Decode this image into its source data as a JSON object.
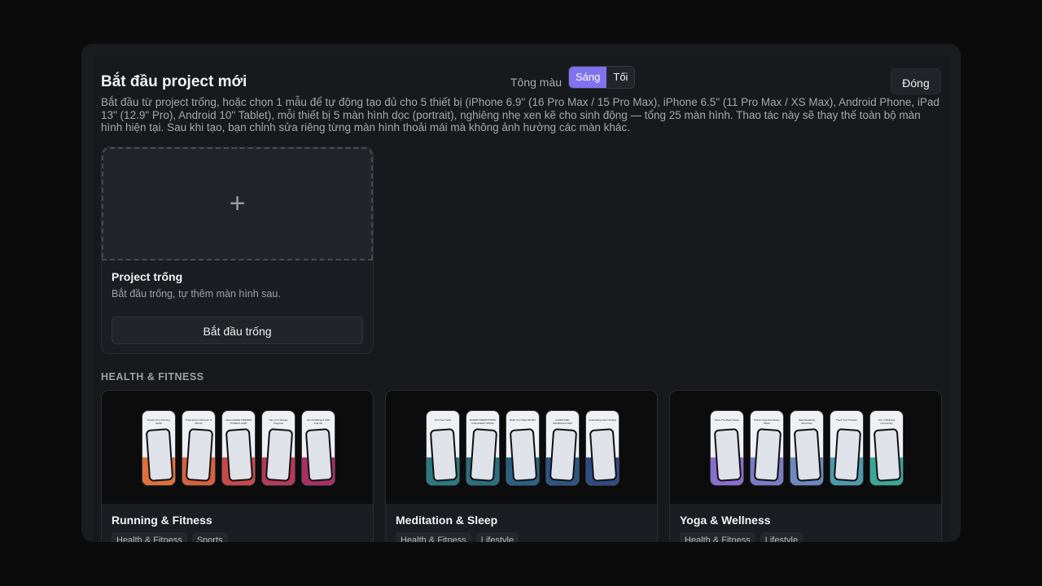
{
  "header": {
    "title": "Bắt đầu project mới",
    "tone_label": "Tông màu",
    "tone_options": [
      "Sáng",
      "Tối"
    ],
    "tone_selected": "Sáng",
    "close_label": "Đóng"
  },
  "description": "Bắt đầu từ project trống, hoặc chọn 1 mẫu để tự động tạo đủ cho 5 thiết bị (iPhone 6.9\" (16 Pro Max / 15 Pro Max), iPhone 6.5\" (11 Pro Max / XS Max), Android Phone, iPad 13\" (12.9\" Pro), Android 10\" Tablet), mỗi thiết bị 5 màn hình dọc (portrait), nghiêng nhẹ xen kẽ cho sinh động — tổng 25 màn hình. Thao tác này sẽ thay thế toàn bộ màn hình hiện tại. Sau khi tạo, bạn chỉnh sửa riêng từng màn hình thoải mái mà không ảnh hưởng các màn khác.",
  "empty_project": {
    "plus_glyph": "+",
    "title": "Project trống",
    "subtitle": "Bắt đầu trống, tự thêm màn hình sau.",
    "button_label": "Bắt đầu trống"
  },
  "section_title": "HEALTH & FITNESS",
  "templates": [
    {
      "title": "Running & Fitness",
      "tags": [
        "Health & Fitness",
        "Sports"
      ],
      "band_colors": [
        "#e0703a",
        "#d8603e",
        "#c94a48",
        "#b8385a",
        "#a93062"
      ],
      "phone_captions": [
        "Reach Your Running Goals",
        "Track Every Kilometer & Minute",
        "CHALLENGE FRIENDS TO BEAT LIMIT",
        "See Your Weekly Progress",
        "Join Challenges With Friends"
      ]
    },
    {
      "title": "Meditation & Sleep",
      "tags": [
        "Health & Fitness",
        "Lifestyle"
      ],
      "band_colors": [
        "#2a7a80",
        "#2a6f82",
        "#2a6284",
        "#2d5686",
        "#2f4c86"
      ],
      "phone_captions": [
        "Find Your Calm",
        "GUIDED MEDITATIONS FOR EVERY MOOD",
        "Build Your Daily Mindful",
        "Guided Daily Mindfulness track",
        "Celebrating Calm Tonight"
      ]
    },
    {
      "title": "Yoga & Wellness",
      "tags": [
        "Health & Fitness",
        "Lifestyle"
      ],
      "band_colors": [
        "#8a6fd0",
        "#7a7cc8",
        "#6a8ac0",
        "#4c9ab0",
        "#3aa69a"
      ],
      "phone_captions": [
        "Move The Body Peace",
        "Follow Yoga Flow Every Week",
        "Daily Breathing Exercises",
        "Track Your Practice",
        "Join a Wellness Community"
      ]
    }
  ]
}
